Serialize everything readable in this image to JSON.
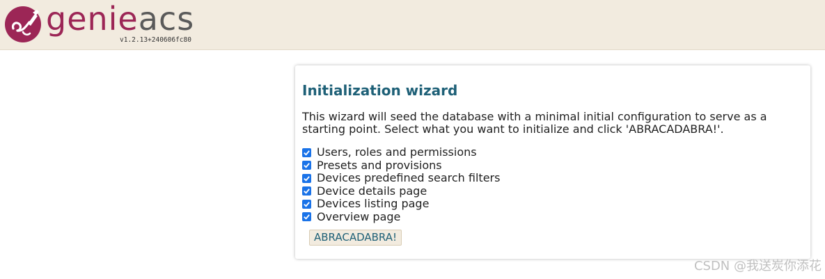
{
  "header": {
    "logo_text_genie": "genie",
    "logo_text_acs": "acs",
    "version": "v1.2.13+240606fc80",
    "colors": {
      "background": "#f2ebdf",
      "brand": "#9c2656",
      "acs": "#5a5a5a"
    }
  },
  "wizard": {
    "title": "Initialization wizard",
    "description": "This wizard will seed the database with a minimal initial configuration to serve as a starting point. Select what you want to initialize and click 'ABRACADABRA!'.",
    "options": [
      {
        "label": "Users, roles and permissions",
        "checked": true
      },
      {
        "label": "Presets and provisions",
        "checked": true
      },
      {
        "label": "Devices predefined search filters",
        "checked": true
      },
      {
        "label": "Device details page",
        "checked": true
      },
      {
        "label": "Devices listing page",
        "checked": true
      },
      {
        "label": "Overview page",
        "checked": true
      }
    ],
    "button_label": "ABRACADABRA!",
    "colors": {
      "title": "#1e6077",
      "checkbox": "#1a73e8"
    }
  },
  "watermark": "CSDN @我送炭你添花"
}
